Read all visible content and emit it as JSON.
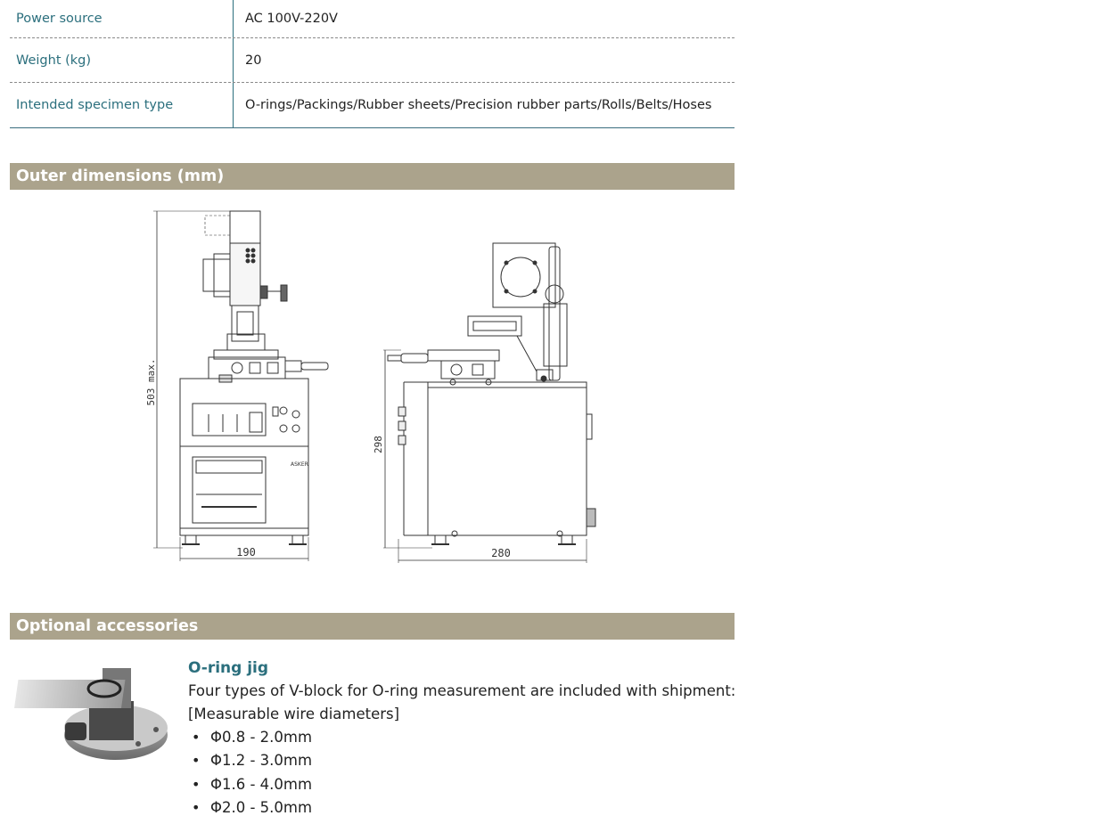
{
  "specs": [
    {
      "key": "Power source",
      "value": "AC 100V-220V"
    },
    {
      "key": "Weight (kg)",
      "value": "20"
    },
    {
      "key": "Intended specimen type",
      "value": "O-rings/Packings/Rubber sheets/Precision rubber parts/Rolls/Belts/Hoses"
    }
  ],
  "sections": {
    "dimensions_title": "Outer dimensions (mm)",
    "accessories_title": "Optional accessories"
  },
  "drawing": {
    "height_max": "503 max.",
    "front_width": "190",
    "side_height": "298",
    "side_depth": "280"
  },
  "accessory": {
    "title": "O-ring jig",
    "description": "Four types of V-block for O-ring measurement are included with shipment:",
    "subheading": "[Measurable wire diameters]",
    "items": [
      "Φ0.8 - 2.0mm",
      "Φ1.2 - 3.0mm",
      "Φ1.6 - 4.0mm",
      "Φ2.0 - 5.0mm"
    ]
  },
  "colors": {
    "accent": "#2b6f7d",
    "section_bar": "#aba38c"
  }
}
